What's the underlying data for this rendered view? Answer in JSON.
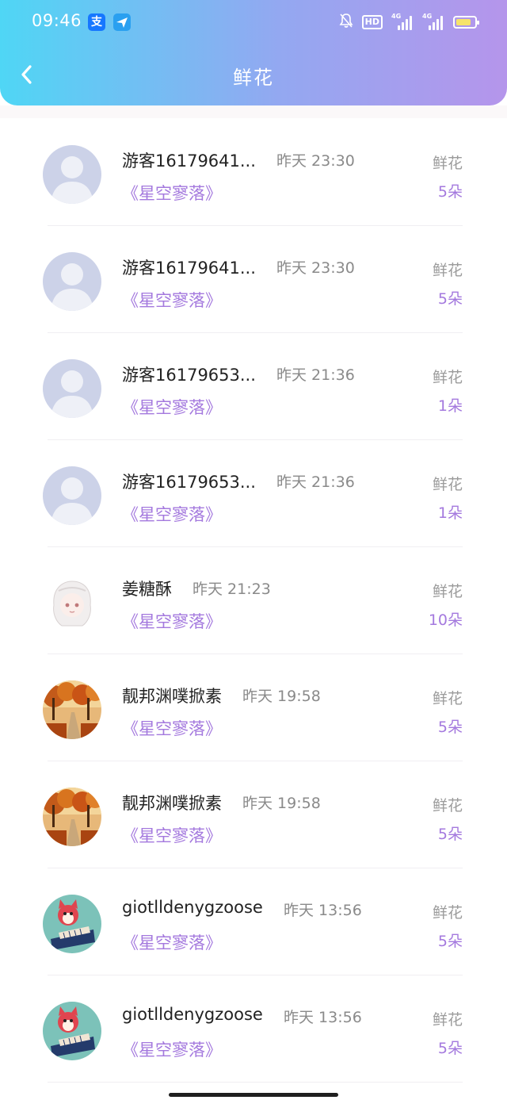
{
  "status_bar": {
    "time": "09:46",
    "alipay_icon_char": "支",
    "hd_label": "HD",
    "network_1": "4G",
    "network_2": "4G"
  },
  "header": {
    "title": "鲜花",
    "back_icon": "chevron-left-icon"
  },
  "colors": {
    "accent": "#a479de",
    "header_start": "#4fd6f5",
    "header_end": "#b595eb"
  },
  "items": [
    {
      "name": "游客16179641...",
      "time": "昨天 23:30",
      "book": "《星空寥落》",
      "flower_label": "鲜花",
      "flower_count": "5朵",
      "avatar": "default"
    },
    {
      "name": "游客16179641...",
      "time": "昨天 23:30",
      "book": "《星空寥落》",
      "flower_label": "鲜花",
      "flower_count": "5朵",
      "avatar": "default"
    },
    {
      "name": "游客16179653...",
      "time": "昨天 21:36",
      "book": "《星空寥落》",
      "flower_label": "鲜花",
      "flower_count": "1朵",
      "avatar": "default"
    },
    {
      "name": "游客16179653...",
      "time": "昨天 21:36",
      "book": "《星空寥落》",
      "flower_label": "鲜花",
      "flower_count": "1朵",
      "avatar": "default"
    },
    {
      "name": "姜糖酥",
      "time": "昨天 21:23",
      "book": "《星空寥落》",
      "flower_label": "鲜花",
      "flower_count": "10朵",
      "avatar": "anime"
    },
    {
      "name": "靓邦渊噗掀素",
      "time": "昨天 19:58",
      "book": "《星空寥落》",
      "flower_label": "鲜花",
      "flower_count": "5朵",
      "avatar": "autumn"
    },
    {
      "name": "靓邦渊噗掀素",
      "time": "昨天 19:58",
      "book": "《星空寥落》",
      "flower_label": "鲜花",
      "flower_count": "5朵",
      "avatar": "autumn"
    },
    {
      "name": "giotlldenygzoose",
      "time": "昨天 13:56",
      "book": "《星空寥落》",
      "flower_label": "鲜花",
      "flower_count": "5朵",
      "avatar": "fox"
    },
    {
      "name": "giotlldenygzoose",
      "time": "昨天 13:56",
      "book": "《星空寥落》",
      "flower_label": "鲜花",
      "flower_count": "5朵",
      "avatar": "fox"
    }
  ]
}
